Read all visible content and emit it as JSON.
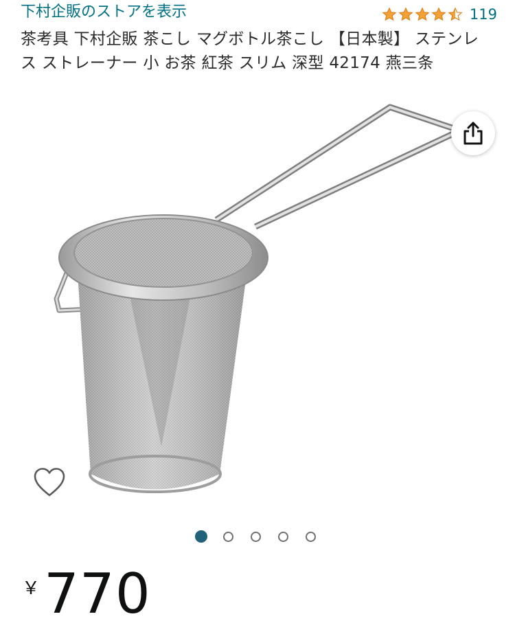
{
  "store": {
    "link_text": "下村企販のストアを表示"
  },
  "rating": {
    "stars": 4.5,
    "max_stars": 5,
    "count": "119",
    "star_color": "#e07a12"
  },
  "product": {
    "title": "茶考具 下村企販 茶こし マグボトル茶こし 【日本製】 ステンレス ストレーナー 小 お茶 紅茶 スリム 深型 42174 燕三条"
  },
  "gallery": {
    "image_count": 5,
    "active_index": 0,
    "accent": "#22617a"
  },
  "icons": {
    "share": "share-icon",
    "favorite": "heart-icon"
  },
  "price": {
    "currency": "￥",
    "amount": "770"
  }
}
